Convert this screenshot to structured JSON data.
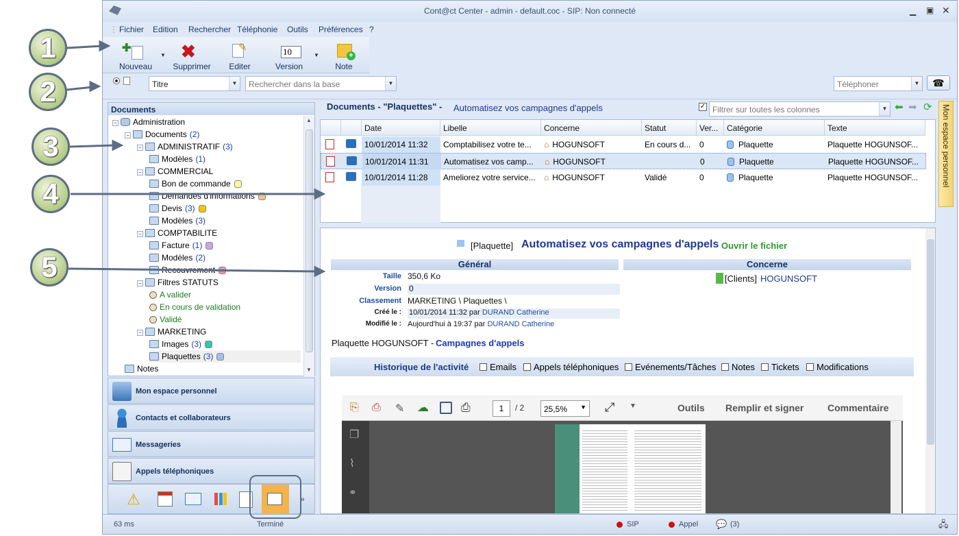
{
  "window": {
    "title": "Cont@ct Center - admin - default.coc - SIP: Non connecté"
  },
  "menu": [
    "Fichier",
    "Edition",
    "Rechercher",
    "Téléphonie",
    "Outils",
    "Préférences",
    "?"
  ],
  "toolbar": {
    "nouveau": "Nouveau",
    "supprimer": "Supprimer",
    "editer": "Editer",
    "version": "Version",
    "note": "Note",
    "version_value": "10"
  },
  "search": {
    "field": "Titre",
    "placeholder": "Rechercher dans la base",
    "phone_placeholder": "Téléphoner"
  },
  "left": {
    "header": "Documents",
    "tree": [
      {
        "label": "Administration",
        "indent": 0,
        "icon": "db"
      },
      {
        "label": "Documents",
        "count": "(2)",
        "indent": 1
      },
      {
        "label": "ADMINISTRATIF",
        "count": "(3)",
        "indent": 2
      },
      {
        "label": "Modèles",
        "count": "(1)",
        "indent": 3
      },
      {
        "label": "COMMERCIAL",
        "indent": 2
      },
      {
        "label": "Bon de commande",
        "indent": 3,
        "badge": "#fff59d"
      },
      {
        "label": "Demandes d'informations",
        "indent": 3,
        "badge": "#f6c28b"
      },
      {
        "label": "Devis",
        "count": "(3)",
        "indent": 3,
        "badge": "#f4c20d"
      },
      {
        "label": "Modèles",
        "count": "(3)",
        "indent": 3
      },
      {
        "label": "COMPTABILITE",
        "indent": 2
      },
      {
        "label": "Facture",
        "count": "(1)",
        "indent": 3,
        "badge": "#c9a4e8"
      },
      {
        "label": "Modèles",
        "count": "(2)",
        "indent": 3
      },
      {
        "label": "Recouvrement",
        "indent": 3,
        "badge": "#e88fb7"
      },
      {
        "label": "Filtres STATUTS",
        "indent": 2
      },
      {
        "label": "A valider",
        "indent": 3,
        "icon": "mag",
        "green": true
      },
      {
        "label": "En cours de validation",
        "indent": 3,
        "icon": "mag",
        "green": true
      },
      {
        "label": "Validé",
        "indent": 3,
        "icon": "mag",
        "green": true
      },
      {
        "label": "MARKETING",
        "indent": 2
      },
      {
        "label": "Images",
        "count": "(3)",
        "indent": 3,
        "badge": "#2fc6b5"
      },
      {
        "label": "Plaquettes",
        "count": "(3)",
        "indent": 3,
        "badge": "#9cc3ec",
        "selected": true
      },
      {
        "label": "Notes",
        "indent": 1
      }
    ],
    "nav": [
      "Mon espace personnel",
      "Contacts et collaborateurs",
      "Messageries",
      "Appels téléphoniques"
    ]
  },
  "docs": {
    "header_prefix": "Documents - \"Plaquettes\" -",
    "header_sub": "Automatisez vos campagnes d'appels",
    "filter_placeholder": "Filtrer sur toutes les colonnes",
    "columns": [
      "Date",
      "Libelle",
      "Concerne",
      "Statut",
      "Ver...",
      "Catégorie",
      "Texte"
    ],
    "rows": [
      [
        "10/01/2014 11:32",
        "Comptabilisez votre te...",
        "HOGUNSOFT",
        "En cours d...",
        "0",
        "Plaquette",
        "Plaquette HOGUNSOF..."
      ],
      [
        "10/01/2014 11:31",
        "Automatisez vos camp...",
        "HOGUNSOFT",
        "",
        "0",
        "Plaquette",
        "Plaquette HOGUNSOF..."
      ],
      [
        "10/01/2014 11:28",
        "Ameliorez votre service...",
        "HOGUNSOFT",
        "Validé",
        "0",
        "Plaquette",
        "Plaquette HOGUNSOF..."
      ]
    ]
  },
  "detail": {
    "tag": "[Plaquette]",
    "title": "Automatisez vos campagnes d'appels",
    "open": "Ouvrir le fichier",
    "general": "Général",
    "concerne": "Concerne",
    "labels": {
      "taille": "Taille",
      "version": "Version",
      "classement": "Classement",
      "cree": "Créé le :",
      "modifie": "Modifié le :"
    },
    "values": {
      "taille": "350,6 Ko",
      "version": "0",
      "classement": "MARKETING \\ Plaquettes \\",
      "cree_date": "10/01/2014 11:32 par ",
      "cree_by": "DURAND Catherine",
      "modifie_date": "Aujourd'hui à 19:37 par ",
      "modifie_by": "DURAND Catherine"
    },
    "concerne_tag": "[Clients]",
    "concerne_val": "HOGUNSOFT",
    "desc_a": "Plaquette HOGUNSOFT -",
    "desc_b": "Campagnes d'appels",
    "hist_title": "Historique de l'activité",
    "hist": [
      "Emails",
      "Appels téléphoniques",
      "Evénements/Tâches",
      "Notes",
      "Tickets",
      "Modifications"
    ]
  },
  "pdf": {
    "page": "1",
    "pages": "/ 2",
    "zoom": "25,5%",
    "outils": "Outils",
    "remplir": "Remplir et signer",
    "commentaire": "Commentaire"
  },
  "side_tab": "Mon espace personnel",
  "status": {
    "ms": "63 ms",
    "state": "Terminé",
    "sip": "SIP",
    "appel": "Appel",
    "msgs": "(3)"
  },
  "callouts": [
    "1",
    "2",
    "3",
    "4",
    "5"
  ]
}
